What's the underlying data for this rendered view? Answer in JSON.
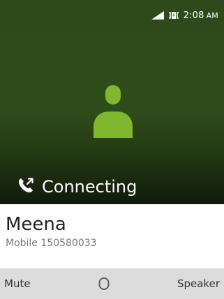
{
  "status_bar": {
    "time": "2:08",
    "ampm": "AM",
    "icons": [
      "signal-icon",
      "battery-icon"
    ]
  },
  "call": {
    "state": "Connecting",
    "state_icon": "call-out-icon",
    "avatar_icon": "person-icon"
  },
  "contact": {
    "name": "Meena",
    "number": "Mobile 150580033"
  },
  "softkeys": {
    "left": "Mute",
    "center_icon": "circle-icon",
    "right": "Speaker"
  },
  "colors": {
    "header_bg": "#2f4c1b",
    "avatar_green": "#7fb82f",
    "softkey_bar": "#dcdcdc"
  }
}
